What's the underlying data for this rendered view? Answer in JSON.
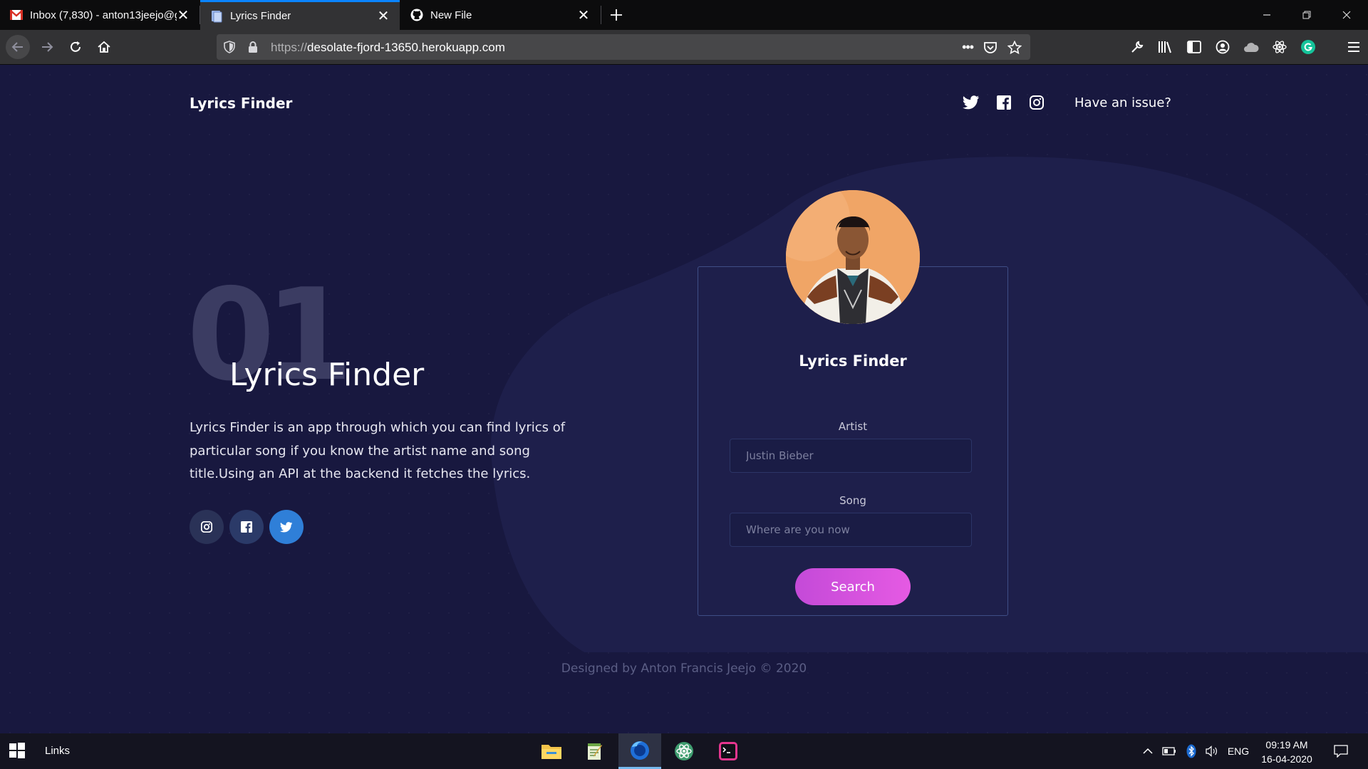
{
  "browser": {
    "tabs": [
      {
        "title": "Inbox (7,830) - anton13jeejo@g",
        "icon": "gmail-icon"
      },
      {
        "title": "Lyrics Finder",
        "icon": "page-icon",
        "active": true
      },
      {
        "title": "New File",
        "icon": "github-icon"
      }
    ],
    "url_protocol": "https://",
    "url_host": "desolate-fjord-13650.herokuapp.com",
    "url_menu": "•••"
  },
  "page": {
    "brand": "Lyrics Finder",
    "nav_issue": "Have an issue?",
    "hero": {
      "number": "01",
      "title": "Lyrics Finder",
      "description": "Lyrics Finder is an app through which you can find lyrics of particular song if you know the artist name and song title.Using an API at the backend it fetches the lyrics."
    },
    "card": {
      "title": "Lyrics Finder",
      "artist_label": "Artist",
      "artist_placeholder": "Justin Bieber",
      "song_label": "Song",
      "song_placeholder": "Where are you now",
      "search_label": "Search"
    },
    "footer": "Designed by Anton Francis Jeejo © 2020"
  },
  "taskbar": {
    "links_label": "Links",
    "lang": "ENG",
    "time": "09:19 AM",
    "date": "16-04-2020"
  },
  "colors": {
    "page_bg": "#18183f",
    "accent": "#d04fe0",
    "twitter": "#2f7fd8",
    "firefox_tab_highlight": "#0a84ff"
  }
}
